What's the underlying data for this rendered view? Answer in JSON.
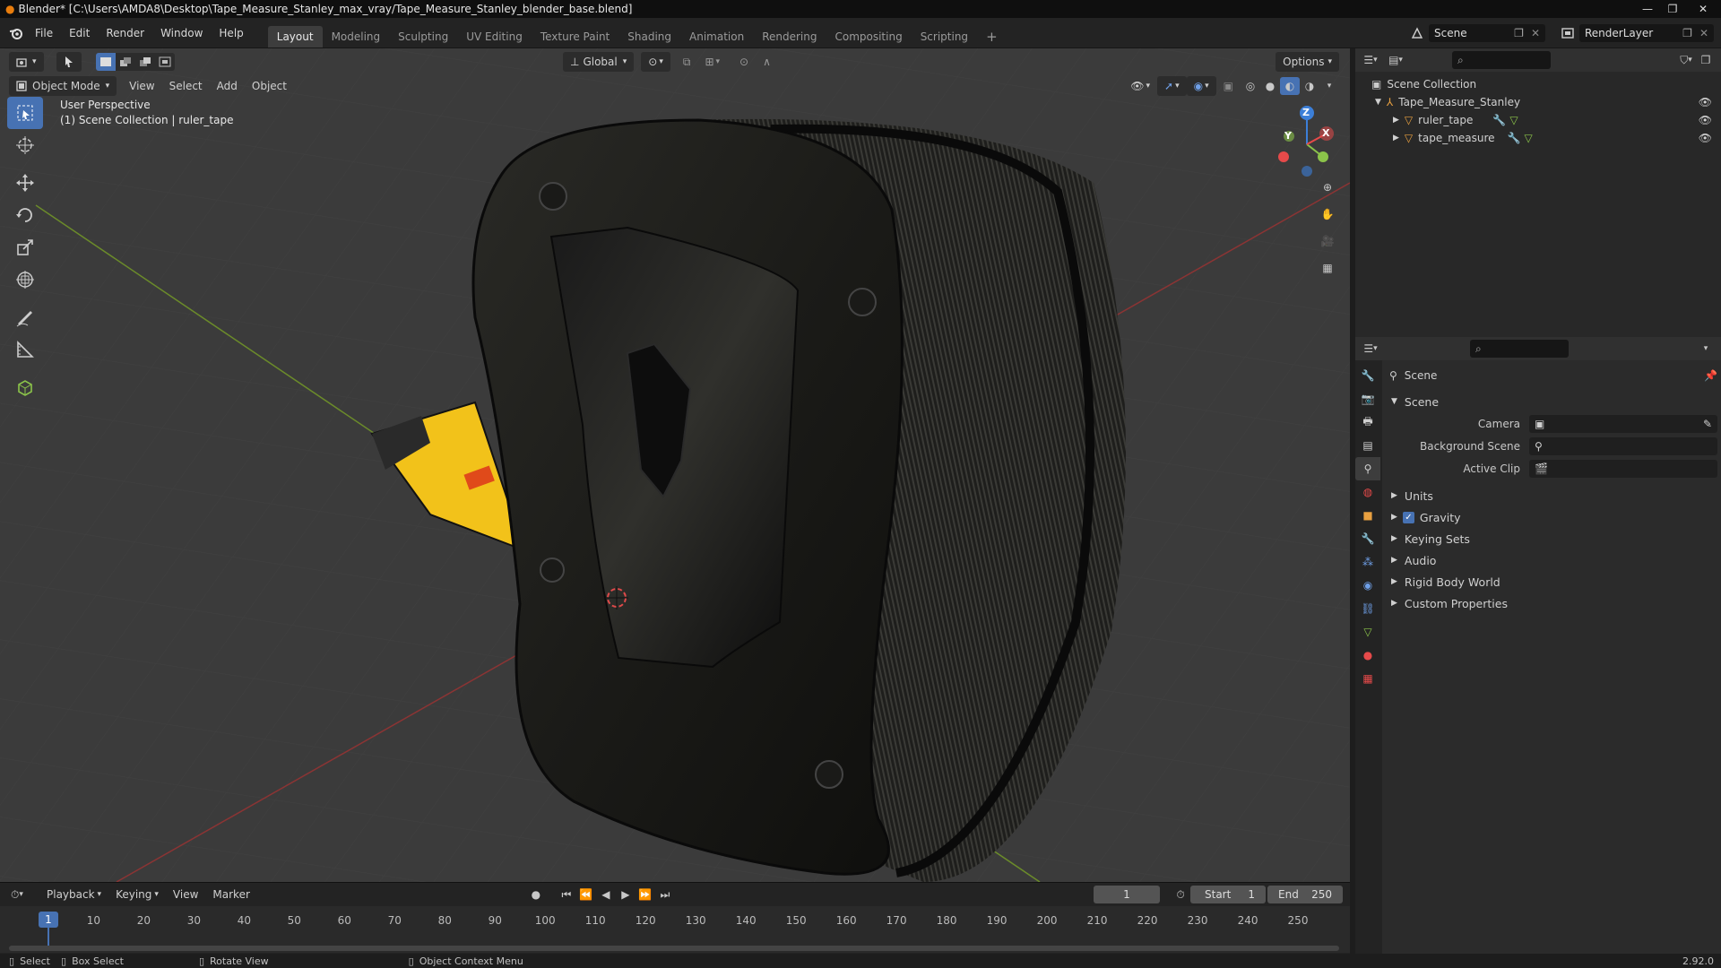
{
  "window": {
    "title": "Blender* [C:\\Users\\AMDA8\\Desktop\\Tape_Measure_Stanley_max_vray/Tape_Measure_Stanley_blender_base.blend]"
  },
  "menu": [
    "File",
    "Edit",
    "Render",
    "Window",
    "Help"
  ],
  "workspaces": [
    "Layout",
    "Modeling",
    "Sculpting",
    "UV Editing",
    "Texture Paint",
    "Shading",
    "Animation",
    "Rendering",
    "Compositing",
    "Scripting"
  ],
  "active_workspace": "Layout",
  "scene_field": "Scene",
  "renderlayer_field": "RenderLayer",
  "viewport": {
    "mode": "Object Mode",
    "menus": [
      "View",
      "Select",
      "Add",
      "Object"
    ],
    "transform_orientation": "Global",
    "options_label": "Options",
    "overlay_title": "User Perspective",
    "overlay_subtitle": "(1) Scene Collection | ruler_tape",
    "gizmo": {
      "x": "X",
      "y": "Y",
      "z": "Z"
    }
  },
  "outliner": {
    "root": "Scene Collection",
    "collection": "Tape_Measure_Stanley",
    "objects": [
      "ruler_tape",
      "tape_measure"
    ]
  },
  "properties": {
    "context": "Scene",
    "section": "Scene",
    "camera_label": "Camera",
    "background_label": "Background Scene",
    "clip_label": "Active Clip",
    "subsections": [
      "Units",
      "Gravity",
      "Keying Sets",
      "Audio",
      "Rigid Body World",
      "Custom Properties"
    ],
    "gravity_checked": true
  },
  "timeline": {
    "menus": [
      "Playback",
      "Keying",
      "View",
      "Marker"
    ],
    "current_frame": "1",
    "start_label": "Start",
    "start_value": "1",
    "end_label": "End",
    "end_value": "250",
    "ticks": [
      "1",
      "10",
      "20",
      "30",
      "40",
      "50",
      "60",
      "70",
      "80",
      "90",
      "100",
      "110",
      "120",
      "130",
      "140",
      "150",
      "160",
      "170",
      "180",
      "190",
      "200",
      "210",
      "220",
      "230",
      "240",
      "250"
    ]
  },
  "statusbar": {
    "select": "Select",
    "box_select": "Box Select",
    "rotate": "Rotate View",
    "context_menu": "Object Context Menu",
    "version": "2.92.0"
  },
  "colors": {
    "accent": "#4772b3",
    "x_axis": "#e64a4a",
    "y_axis": "#8bc34a",
    "z_axis": "#3c7fd8",
    "tape_yellow": "#f2c21a"
  }
}
